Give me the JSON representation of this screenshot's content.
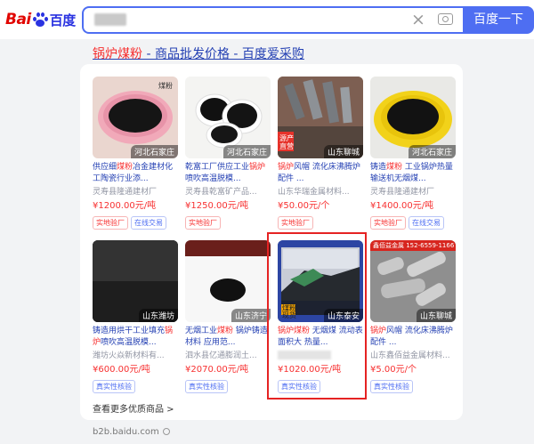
{
  "header": {
    "logo_part1": "Bai",
    "logo_part2": "百度",
    "search_button": "百度一下",
    "clear_icon": "×"
  },
  "result": {
    "title_highlight": "锅炉煤粉",
    "title_rest": " - 商品批发价格 - 百度爱采购"
  },
  "products": [
    {
      "image_label": "煤粉",
      "location": "河北石家庄",
      "name_pre": "供应细",
      "name_hl": "煤粉",
      "name_post": "冶金建材化工陶瓷行业添...",
      "seller": "灵寿县隆通建材厂",
      "price": "¥1200.00元/吨",
      "tags": [
        "实地验厂",
        "在线交易"
      ]
    },
    {
      "image_label": "",
      "location": "河北石家庄",
      "name_pre": "乾富工厂供应工业",
      "name_hl": "锅炉",
      "name_post": "喷吹高温脱模...",
      "seller": "灵寿县乾富矿产品...",
      "price": "¥1250.00元/吨",
      "tags": [
        "实地验厂"
      ]
    },
    {
      "image_label": "源产 直营",
      "location": "山东聊城",
      "name_pre": "",
      "name_hl": "锅炉",
      "name_post": "风帽 流化床沸腾炉配件 ...",
      "seller": "山东华瑞金属材料...",
      "price": "¥50.00元/个",
      "tags": [
        "实地验厂"
      ]
    },
    {
      "image_label": "",
      "location": "河北石家庄",
      "name_pre": "铸造",
      "name_hl": "煤粉",
      "name_post": " 工业锅炉热量输送机无烟煤...",
      "seller": "灵寿县隆通建材厂",
      "price": "¥1400.00元/吨",
      "tags": [
        "实地验厂",
        "在线交易"
      ]
    },
    {
      "image_label": "",
      "location": "山东潍坊",
      "name_pre": "铸造用烘干工业填充",
      "name_hl": "锅炉",
      "name_post": "喷吹高温脱模...",
      "seller": "潍坊火焱新材料有...",
      "price": "¥600.00元/吨",
      "tags": [
        "真实性核验"
      ]
    },
    {
      "image_label": "",
      "location": "山东济宁",
      "name_pre": "无烟工业",
      "name_hl": "煤粉",
      "name_post": " 锅炉铸造材料 应用范...",
      "seller": "泗水县亿通膨润土...",
      "price": "¥2070.00元/吨",
      "tags": [
        "真实性核验"
      ]
    },
    {
      "image_label": "煤粉 现货",
      "location": "山东泰安",
      "name_pre": "",
      "name_hl": "锅炉煤粉",
      "name_post": " 无烟煤 流动表面积大 热量...",
      "seller": "",
      "price": "¥1020.00元/吨",
      "tags": [
        "真实性核验"
      ]
    },
    {
      "image_label": "鑫佰益金属 152-6559-1166",
      "location": "山东聊城",
      "name_pre": "",
      "name_hl": "锅炉",
      "name_post": "风帽 流化床沸腾炉配件 ...",
      "seller": "山东鑫佰益金属材料...",
      "price": "¥5.00元/个",
      "tags": [
        "真实性核验"
      ]
    }
  ],
  "more_link": "查看更多优质商品 >",
  "footer_url": "b2b.baidu.com",
  "colors": {
    "accent": "#4e6ef2",
    "highlight": "#f73131",
    "link": "#2440b3"
  }
}
